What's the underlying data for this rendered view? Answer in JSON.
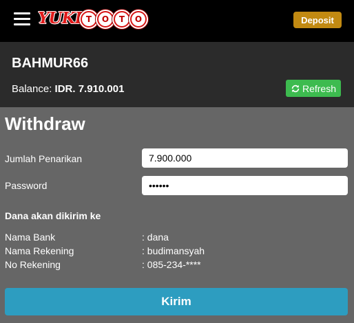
{
  "header": {
    "menu_icon": "hamburger-menu-icon",
    "logo": {
      "word": "YUKI",
      "balls": [
        "T",
        "O",
        "T",
        "O"
      ]
    },
    "deposit_label": "Deposit"
  },
  "account": {
    "username": "BAHMUR66",
    "balance_label": "Balance:",
    "balance_value": "IDR. 7.910.001",
    "refresh_label": "Refresh",
    "refresh_icon": "refresh-icon"
  },
  "withdraw": {
    "title": "Withdraw",
    "amount_label": "Jumlah Penarikan",
    "amount_value": "7.900.000",
    "password_label": "Password",
    "password_value": "••••••"
  },
  "destination": {
    "heading": "Dana akan dikirim ke",
    "rows": [
      {
        "label": "Nama Bank",
        "value": ": dana"
      },
      {
        "label": "Nama Rekening",
        "value": ": budimansyah"
      },
      {
        "label": "No Rekening",
        "value": ": 085-234-****"
      }
    ]
  },
  "submit_label": "Kirim",
  "colors": {
    "topbar": "#000000",
    "account_bg": "#2b2b2b",
    "page_bg": "#666666",
    "deposit": "#c28a12",
    "refresh": "#3dbb4f",
    "submit": "#2d9dc0",
    "logo_red": "#d81515"
  }
}
